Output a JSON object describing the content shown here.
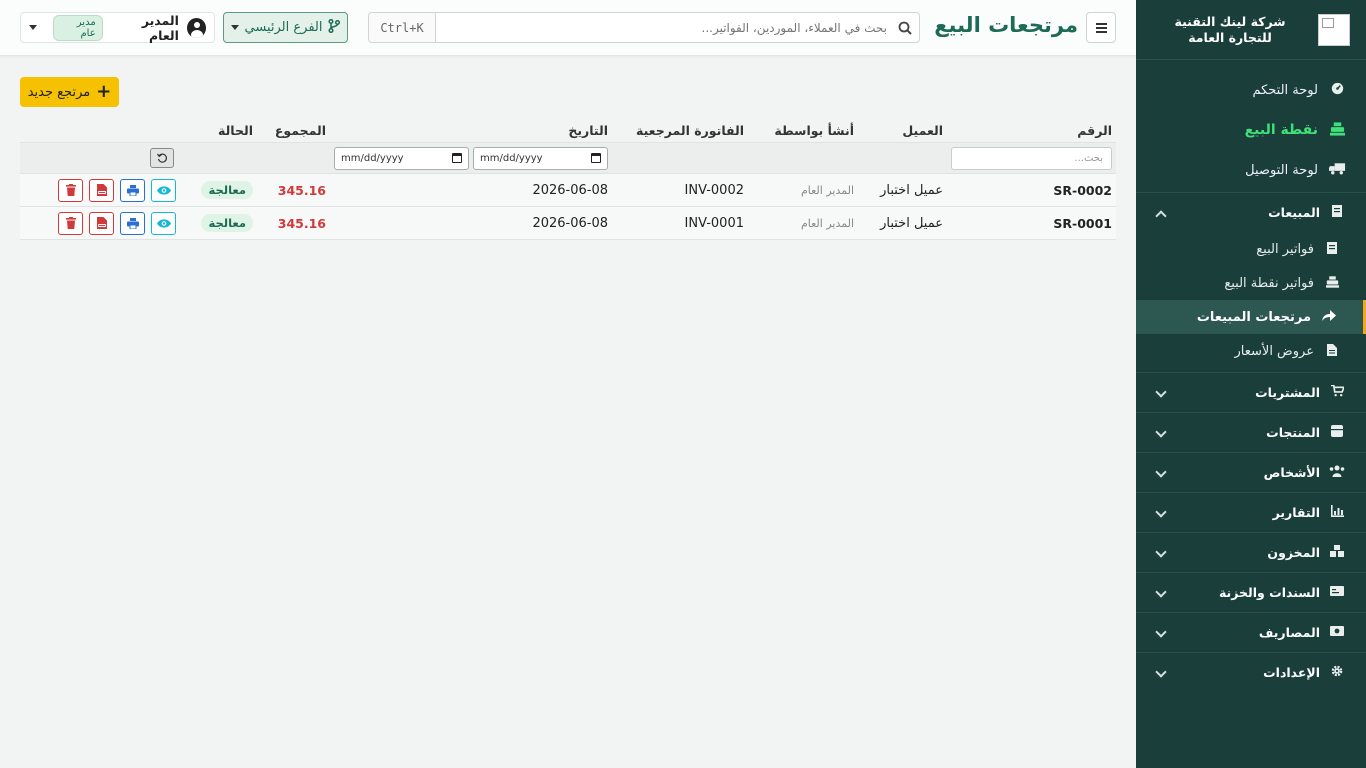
{
  "app": {
    "company_name": "شركة لينك التقنية للتجارة العامة",
    "page_title": "مرتجعات البيع"
  },
  "header": {
    "search_placeholder": "بحث في العملاء، الموردين، الفواتير...",
    "search_shortcut": "Ctrl+K",
    "branch_label": "الفرع الرئيسي",
    "user_name": "المدير العام",
    "user_role": "مدير عام"
  },
  "sidebar": {
    "top_items": [
      {
        "label": "لوحة التحكم",
        "icon": "dashboard-icon"
      },
      {
        "label": "نقطة البيع",
        "icon": "cash-register-icon"
      },
      {
        "label": "لوحة التوصيل",
        "icon": "truck-icon"
      }
    ],
    "sales_group": {
      "label": "المبيعات",
      "icon": "receipt-icon",
      "items": [
        {
          "label": "فواتير البيع",
          "icon": "receipt-icon"
        },
        {
          "label": "فواتير نقطة البيع",
          "icon": "cash-register-icon"
        },
        {
          "label": "مرتجعات المبيعات",
          "icon": "share-arrow-icon",
          "active": true
        },
        {
          "label": "عروض الأسعار",
          "icon": "file-icon"
        }
      ]
    },
    "groups": [
      {
        "label": "المشتريات",
        "icon": "cart-icon"
      },
      {
        "label": "المنتجات",
        "icon": "box-icon"
      },
      {
        "label": "الأشخاص",
        "icon": "users-icon"
      },
      {
        "label": "التقارير",
        "icon": "chart-icon"
      },
      {
        "label": "المخزون",
        "icon": "warehouse-icon"
      },
      {
        "label": "السندات والخزنة",
        "icon": "money-icon"
      },
      {
        "label": "المصاريف",
        "icon": "cash-icon"
      },
      {
        "label": "الإعدادات",
        "icon": "gear-icon"
      }
    ],
    "accent_color": "#f3a81b",
    "pos_color": "#3fe07a"
  },
  "main": {
    "new_button_label": "مرتجع جديد",
    "table": {
      "headers": {
        "number": "الرقم",
        "customer": "العميل",
        "created_by": "أنشأ بواسطة",
        "ref_invoice": "الفاتورة المرجعية",
        "date": "التاريخ",
        "total": "المجموع",
        "status": "الحالة"
      },
      "filters": {
        "search_placeholder": "بحث...",
        "date_from": "mm/dd/yyyy",
        "date_to": "mm/dd/yyyy"
      },
      "rows": [
        {
          "number": "SR-0002",
          "customer": "عميل اختبار",
          "created_by": "المدير العام",
          "ref_invoice": "INV-0002",
          "date": "2026-06-08",
          "total": "345.16",
          "status": "معالجة"
        },
        {
          "number": "SR-0001",
          "customer": "عميل اختبار",
          "created_by": "المدير العام",
          "ref_invoice": "INV-0001",
          "date": "2026-06-08",
          "total": "345.16",
          "status": "معالجة"
        }
      ]
    }
  }
}
